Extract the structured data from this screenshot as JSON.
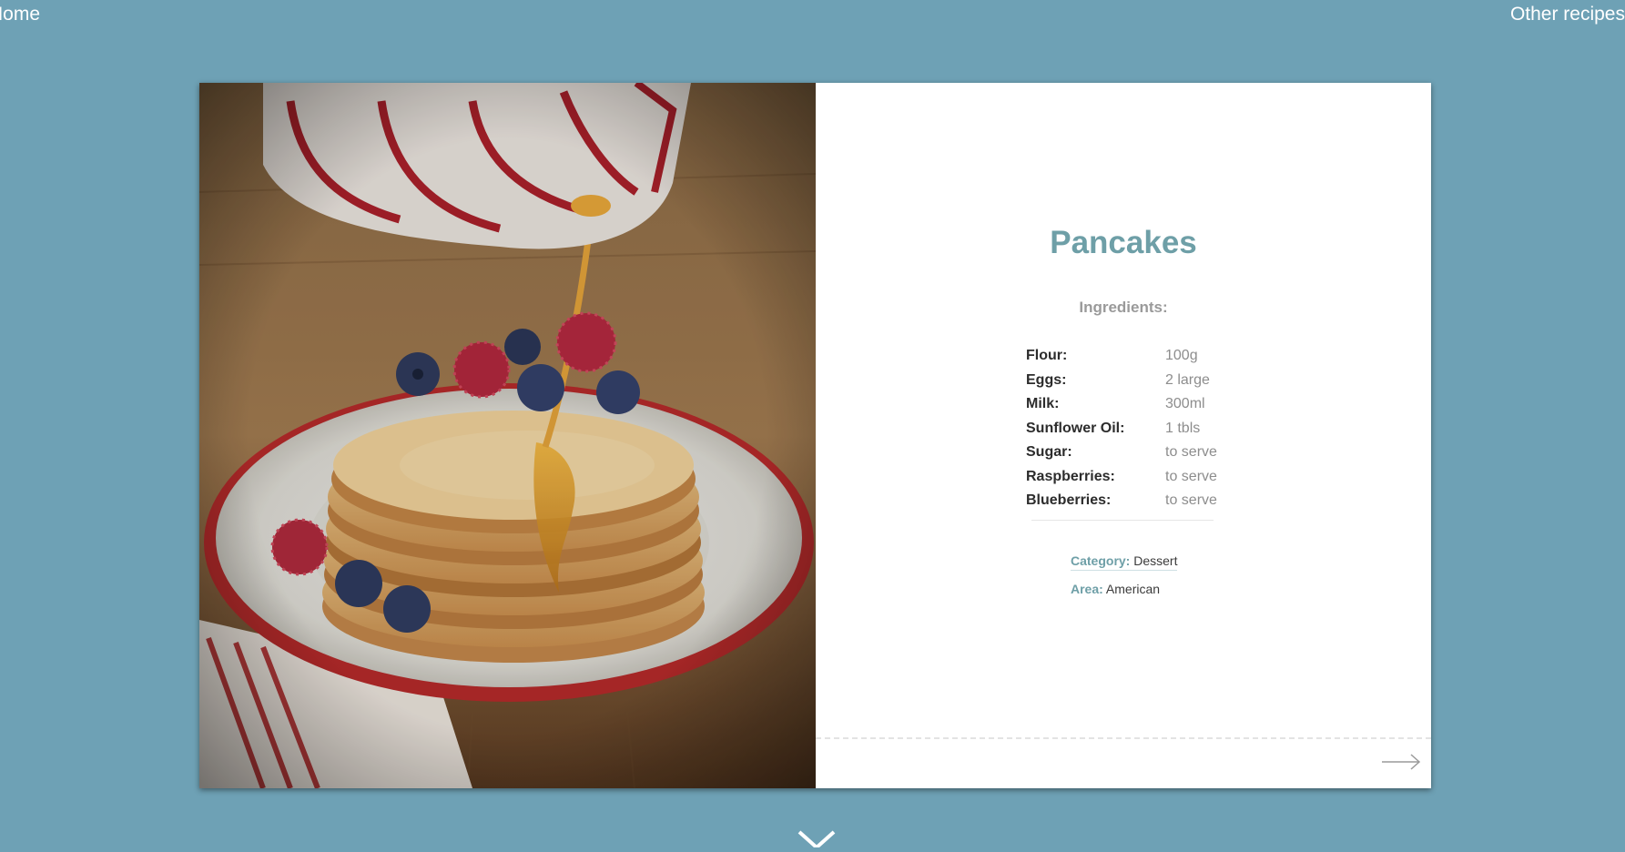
{
  "nav": {
    "home_label": "Home",
    "other_label": "Other recipes"
  },
  "recipe": {
    "title": "Pancakes",
    "ingredients_heading": "Ingredients:",
    "ingredients": [
      {
        "name": "Flour:",
        "measure": "100g"
      },
      {
        "name": "Eggs:",
        "measure": "2 large"
      },
      {
        "name": "Milk:",
        "measure": "300ml"
      },
      {
        "name": "Sunflower Oil:",
        "measure": "1 tbls"
      },
      {
        "name": "Sugar:",
        "measure": "to serve"
      },
      {
        "name": "Raspberries:",
        "measure": "to serve"
      },
      {
        "name": "Blueberries:",
        "measure": "to serve"
      }
    ],
    "category_label": "Category:",
    "category_value": "Dessert",
    "area_label": "Area:",
    "area_value": "American"
  },
  "icons": {
    "next": "arrow-right-icon",
    "scroll": "chevron-down-icon"
  },
  "colors": {
    "page_background": "#6ea1b5",
    "accent": "#6e9fa7",
    "card_background": "#ffffff"
  }
}
